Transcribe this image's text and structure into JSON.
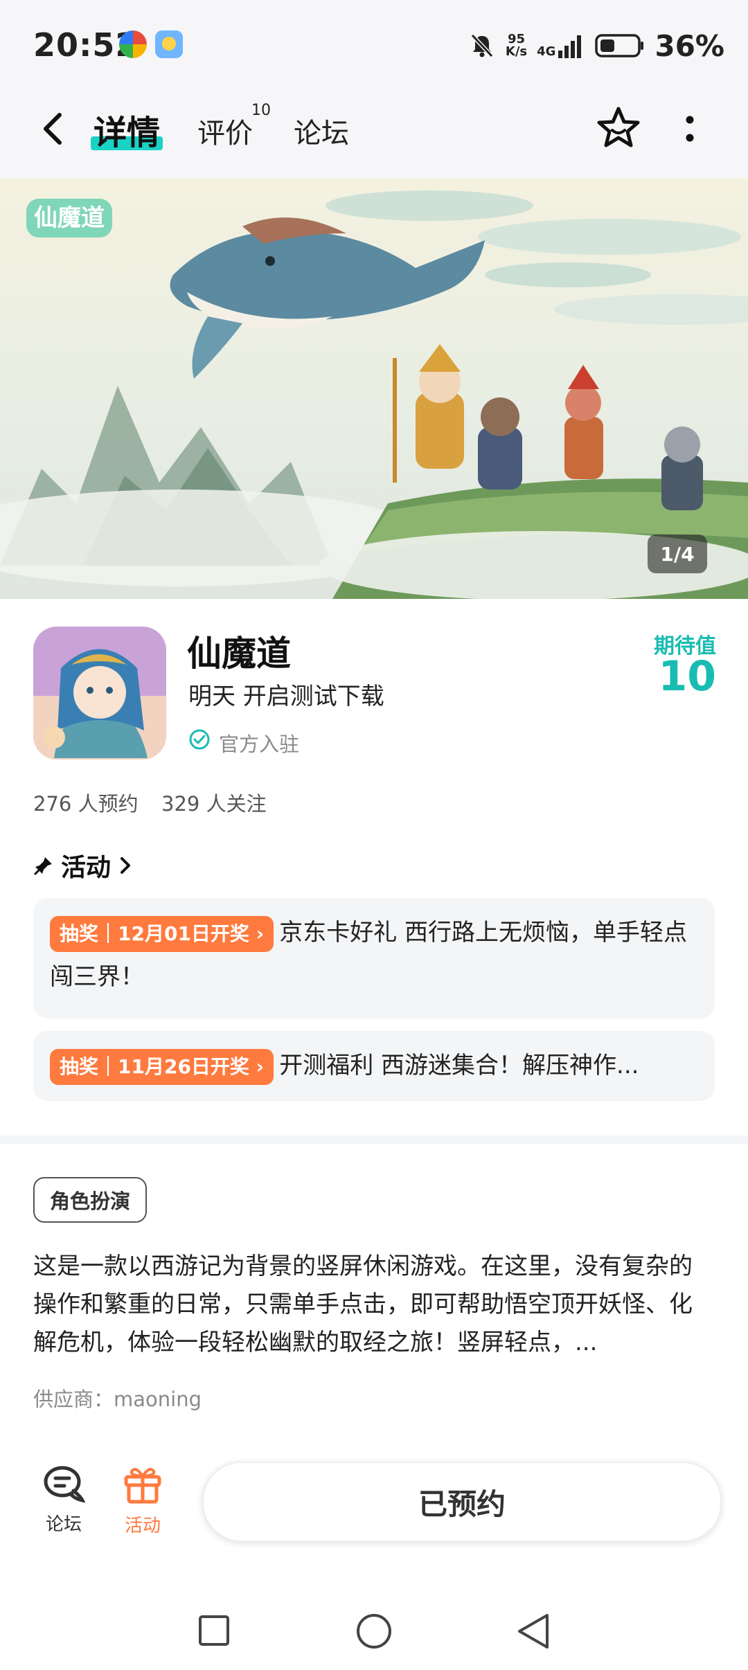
{
  "status_bar": {
    "time": "20:52",
    "net_speed_top": "95",
    "net_speed_bottom": "K/s",
    "network": "4G",
    "battery": "36%"
  },
  "nav": {
    "tabs": [
      {
        "label": "详情",
        "active": true
      },
      {
        "label": "评价",
        "count": "10"
      },
      {
        "label": "论坛"
      }
    ]
  },
  "banner": {
    "logo_text": "仙魔道",
    "counter": "1/4"
  },
  "game": {
    "title": "仙魔道",
    "status": "明天 开启测试下载",
    "official": "官方入驻",
    "expectation_label": "期待值",
    "expectation_value": "10",
    "reserve_count": "276 人预约",
    "follow_count": "329 人关注"
  },
  "activities": {
    "heading": "活动",
    "items": [
      {
        "tag": "抽奖｜12月01日开奖",
        "text": "京东卡好礼 西行路上无烦恼，单手轻点闯三界！"
      },
      {
        "tag": "抽奖｜11月26日开奖",
        "text": "开测福利 西游迷集合！解压神作..."
      }
    ]
  },
  "genre": "角色扮演",
  "description": "这是一款以西游记为背景的竖屏休闲游戏。在这里，没有复杂的操作和繁重的日常，只需单手点击，即可帮助悟空顶开妖怪、化解危机，体验一段轻松幽默的取经之旅！竖屏轻点，...",
  "supplier": "供应商：maoning",
  "bottom_bar": {
    "forum_label": "论坛",
    "activity_label": "活动",
    "reserved_label": "已预约"
  },
  "colors": {
    "accent": "#19d3c5",
    "expectation": "#19bcb1",
    "tag": "#ff7a3e",
    "activity_icon": "#ff7a3e"
  }
}
